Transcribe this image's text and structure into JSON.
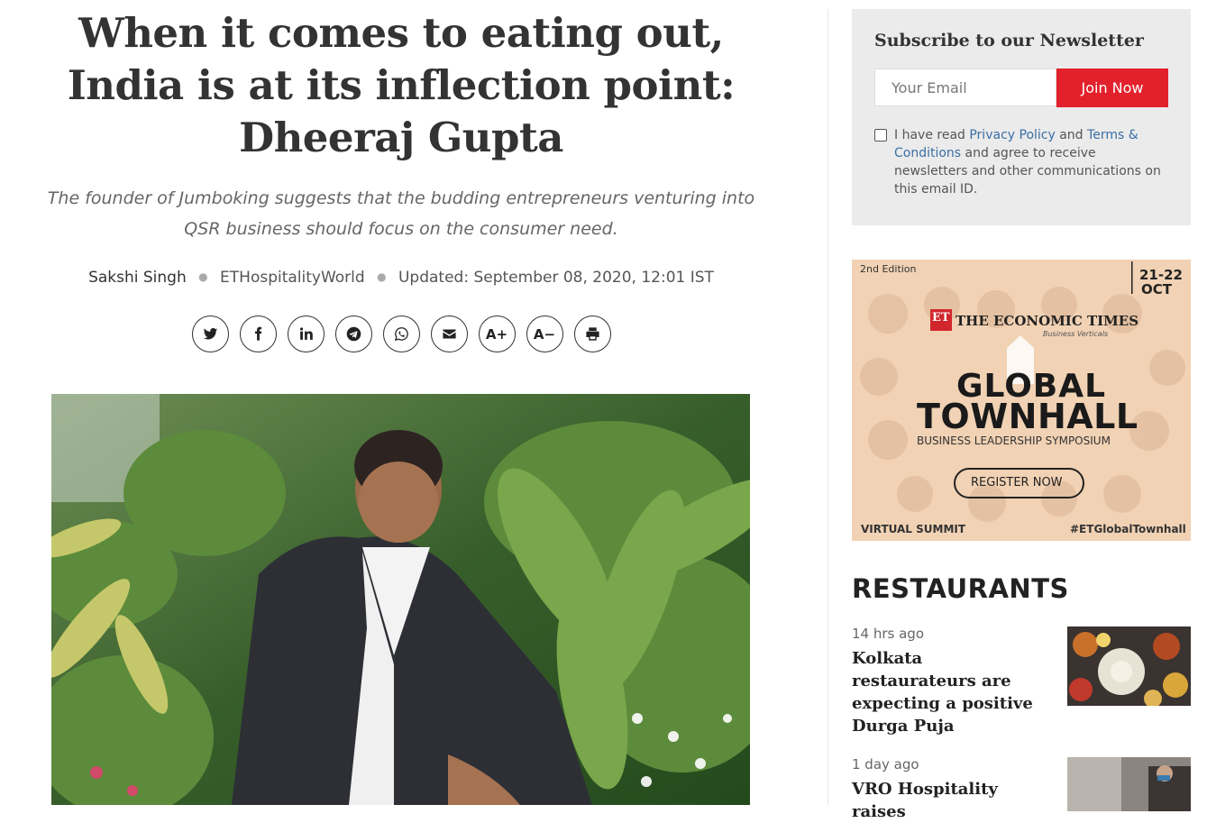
{
  "article": {
    "headline": "When it comes to eating out, India is at its inflection point: Dheeraj Gupta",
    "summary": "The founder of Jumboking suggests that the budding entrepreneurs venturing into QSR business should focus on the consumer need.",
    "author": "Sakshi Singh",
    "source": "ETHospitalityWorld",
    "updated": "Updated: September 08, 2020, 12:01 IST"
  },
  "share_buttons": [
    {
      "name": "twitter-icon"
    },
    {
      "name": "facebook-icon"
    },
    {
      "name": "linkedin-icon"
    },
    {
      "name": "telegram-icon"
    },
    {
      "name": "whatsapp-icon"
    },
    {
      "name": "email-icon"
    },
    {
      "name": "font-increase",
      "label": "A+"
    },
    {
      "name": "font-decrease",
      "label": "A−"
    },
    {
      "name": "print-icon"
    }
  ],
  "newsletter": {
    "title": "Subscribe to our Newsletter",
    "email_placeholder": "Your Email",
    "join_label": "Join Now",
    "consent_prefix": "I have read ",
    "privacy_link": "Privacy Policy",
    "consent_and": " and ",
    "terms_link": "Terms & Conditions",
    "consent_suffix": " and agree to receive newsletters and other communications on this email ID."
  },
  "ad": {
    "edition": "2nd Edition",
    "date_days": "21-22",
    "date_month": "OCT",
    "brand_logo": "ET",
    "brand_name": "THE ECONOMIC TIMES",
    "brand_sub": "Business Verticals",
    "title_line1": "GLOBAL",
    "title_line2": "TOWNHALL",
    "subtitle": "BUSINESS LEADERSHIP SYMPOSIUM",
    "cta": "REGISTER NOW",
    "footer_left": "VIRTUAL SUMMIT",
    "footer_right": "#ETGlobalTownhall"
  },
  "restaurants": {
    "section_title": "RESTAURANTS",
    "items": [
      {
        "time": "14 hrs ago",
        "title": "Kolkata restaurateurs are expecting a positive Durga Puja"
      },
      {
        "time": "1 day ago",
        "title": "VRO Hospitality raises"
      }
    ]
  },
  "colors": {
    "accent_red": "#e2212c",
    "link_blue": "#3a6ea5",
    "newsletter_bg": "#ebebeb",
    "ad_bg": "#f1d1b3"
  }
}
